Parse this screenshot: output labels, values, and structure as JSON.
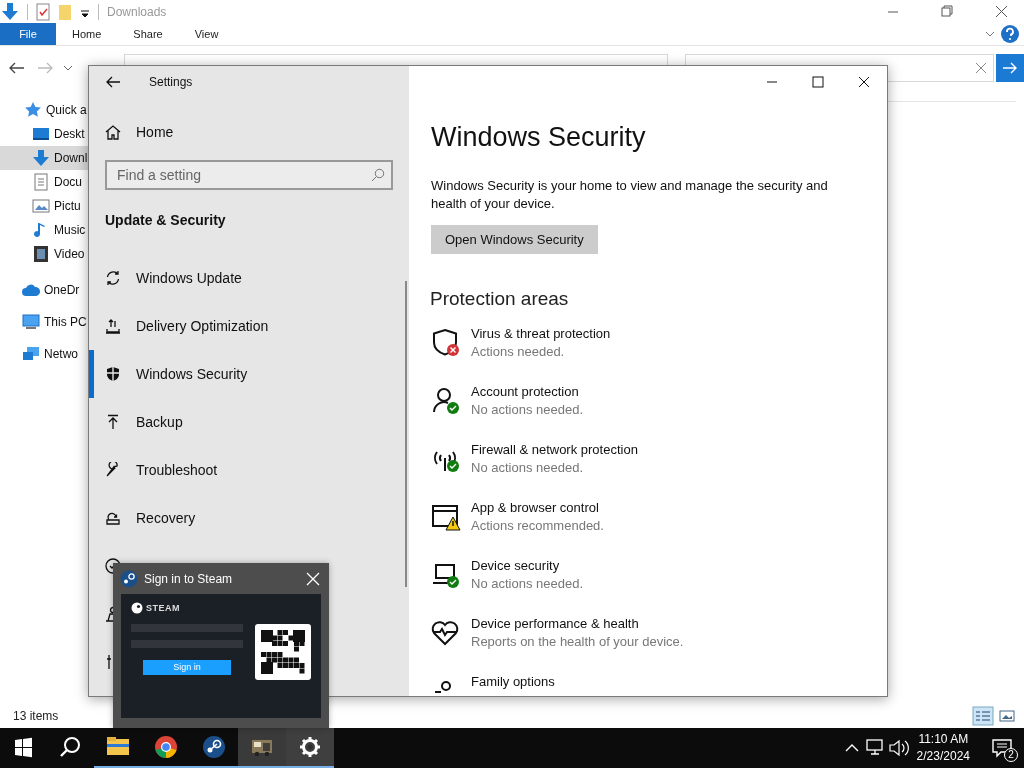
{
  "explorer": {
    "title": "Downloads",
    "ribbon_tabs": [
      {
        "label": "File",
        "selected": true
      },
      {
        "label": "Home",
        "selected": false
      },
      {
        "label": "Share",
        "selected": false
      },
      {
        "label": "View",
        "selected": false
      }
    ],
    "nav_pane": [
      {
        "label": "Quick a",
        "kind": "star",
        "selected": false,
        "children": [
          {
            "label": "Deskt",
            "kind": "desktop",
            "selected": false
          },
          {
            "label": "Downl",
            "kind": "download",
            "selected": true
          },
          {
            "label": "Docu",
            "kind": "document",
            "selected": false
          },
          {
            "label": "Pictu",
            "kind": "pictures",
            "selected": false
          },
          {
            "label": "Music",
            "kind": "music",
            "selected": false
          },
          {
            "label": "Video",
            "kind": "video",
            "selected": false
          }
        ]
      },
      {
        "label": "OneDr",
        "kind": "cloud",
        "selected": false
      },
      {
        "label": "This PC",
        "kind": "pc",
        "selected": false
      },
      {
        "label": "Netwo",
        "kind": "network",
        "selected": false
      }
    ],
    "status": "13 items"
  },
  "settings": {
    "title": "Settings",
    "home": "Home",
    "search": {
      "placeholder": "Find a setting"
    },
    "section": "Update & Security",
    "nav": [
      {
        "label": "Windows Update",
        "kind": "update",
        "selected": false
      },
      {
        "label": "Delivery Optimization",
        "kind": "delivery",
        "selected": false
      },
      {
        "label": "Windows Security",
        "kind": "shield",
        "selected": true
      },
      {
        "label": "Backup",
        "kind": "backup",
        "selected": false
      },
      {
        "label": "Troubleshoot",
        "kind": "wrench",
        "selected": false
      },
      {
        "label": "Recovery",
        "kind": "recovery",
        "selected": false
      },
      {
        "kind": "activation",
        "selected": false
      },
      {
        "kind": "finddevice",
        "selected": false
      },
      {
        "kind": "developer",
        "selected": false
      }
    ],
    "heading": "Windows Security",
    "description": "Windows Security is your home to view and manage the security and health of your device.",
    "open_button": "Open Windows Security",
    "areas_heading": "Protection areas",
    "areas": [
      {
        "title": "Virus & threat protection",
        "status": "Actions needed.",
        "kind": "shield",
        "alert": true,
        "warning": false,
        "verified": false
      },
      {
        "title": "Account protection",
        "status": "No actions needed.",
        "kind": "person",
        "alert": false,
        "warning": false,
        "verified": true
      },
      {
        "title": "Firewall & network protection",
        "status": "No actions needed.",
        "kind": "antenna",
        "alert": false,
        "warning": false,
        "verified": true
      },
      {
        "title": "App & browser control",
        "status": "Actions recommended.",
        "kind": "window",
        "alert": false,
        "warning": true,
        "verified": false
      },
      {
        "title": "Device security",
        "status": "No actions needed.",
        "kind": "laptop",
        "alert": false,
        "warning": false,
        "verified": true
      },
      {
        "title": "Device performance & health",
        "status": "Reports on the health of your device.",
        "kind": "heart",
        "alert": false,
        "warning": false,
        "verified": false
      },
      {
        "title": "Family options",
        "kind": "family",
        "alert": false,
        "warning": false,
        "verified": false
      }
    ]
  },
  "steam_preview": {
    "title": "Sign in to Steam",
    "brand": "STEAM",
    "sign_in": "Sign in"
  },
  "taskbar": {
    "apps": [
      {
        "kind": "explorer",
        "open": true,
        "active": false,
        "hovered": false
      },
      {
        "kind": "chrome",
        "open": true,
        "active": false,
        "hovered": false
      },
      {
        "kind": "steam",
        "open": true,
        "active": false,
        "hovered": false
      },
      {
        "kind": "tool",
        "open": true,
        "active": false,
        "hovered": true
      },
      {
        "kind": "settings",
        "open": true,
        "active": true,
        "hovered": false
      }
    ],
    "time": "11:10 AM",
    "date": "2/23/2024",
    "notifications": "2"
  }
}
